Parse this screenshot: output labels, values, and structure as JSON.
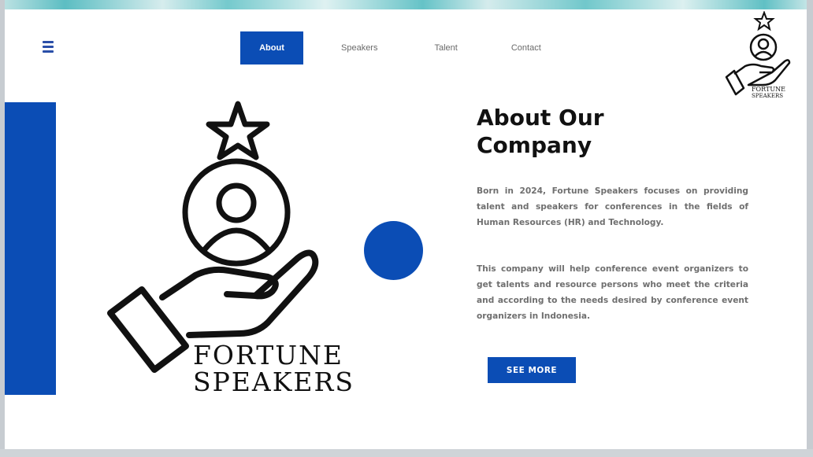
{
  "nav": {
    "items": [
      {
        "label": "About",
        "active": true
      },
      {
        "label": "Speakers",
        "active": false
      },
      {
        "label": "Talent",
        "active": false
      },
      {
        "label": "Contact",
        "active": false
      }
    ]
  },
  "brand": {
    "logo_line1": "FORTUNE",
    "logo_line2": "SPEAKERS",
    "corner_logo_line1": "FORTUNE",
    "corner_logo_line2": "SPEAKERS"
  },
  "about": {
    "title_line1": "About Our",
    "title_line2": "Company",
    "paragraph_1": "Born in 2024, Fortune Speakers focuses on providing talent and speakers for conferences in the fields of Human Resources (HR) and Technology.",
    "paragraph_2": "This company will help conference event organizers to get talents and resource persons who meet the criteria and according to the needs desired by conference event organizers in Indonesia.",
    "cta_label": "SEE MORE"
  },
  "colors": {
    "accent_blue": "#0b4db5",
    "text_dark": "#111111",
    "text_grey": "#6f6f6f"
  },
  "icons": [
    "menu-icon",
    "star-icon",
    "person-icon",
    "hand-icon"
  ]
}
